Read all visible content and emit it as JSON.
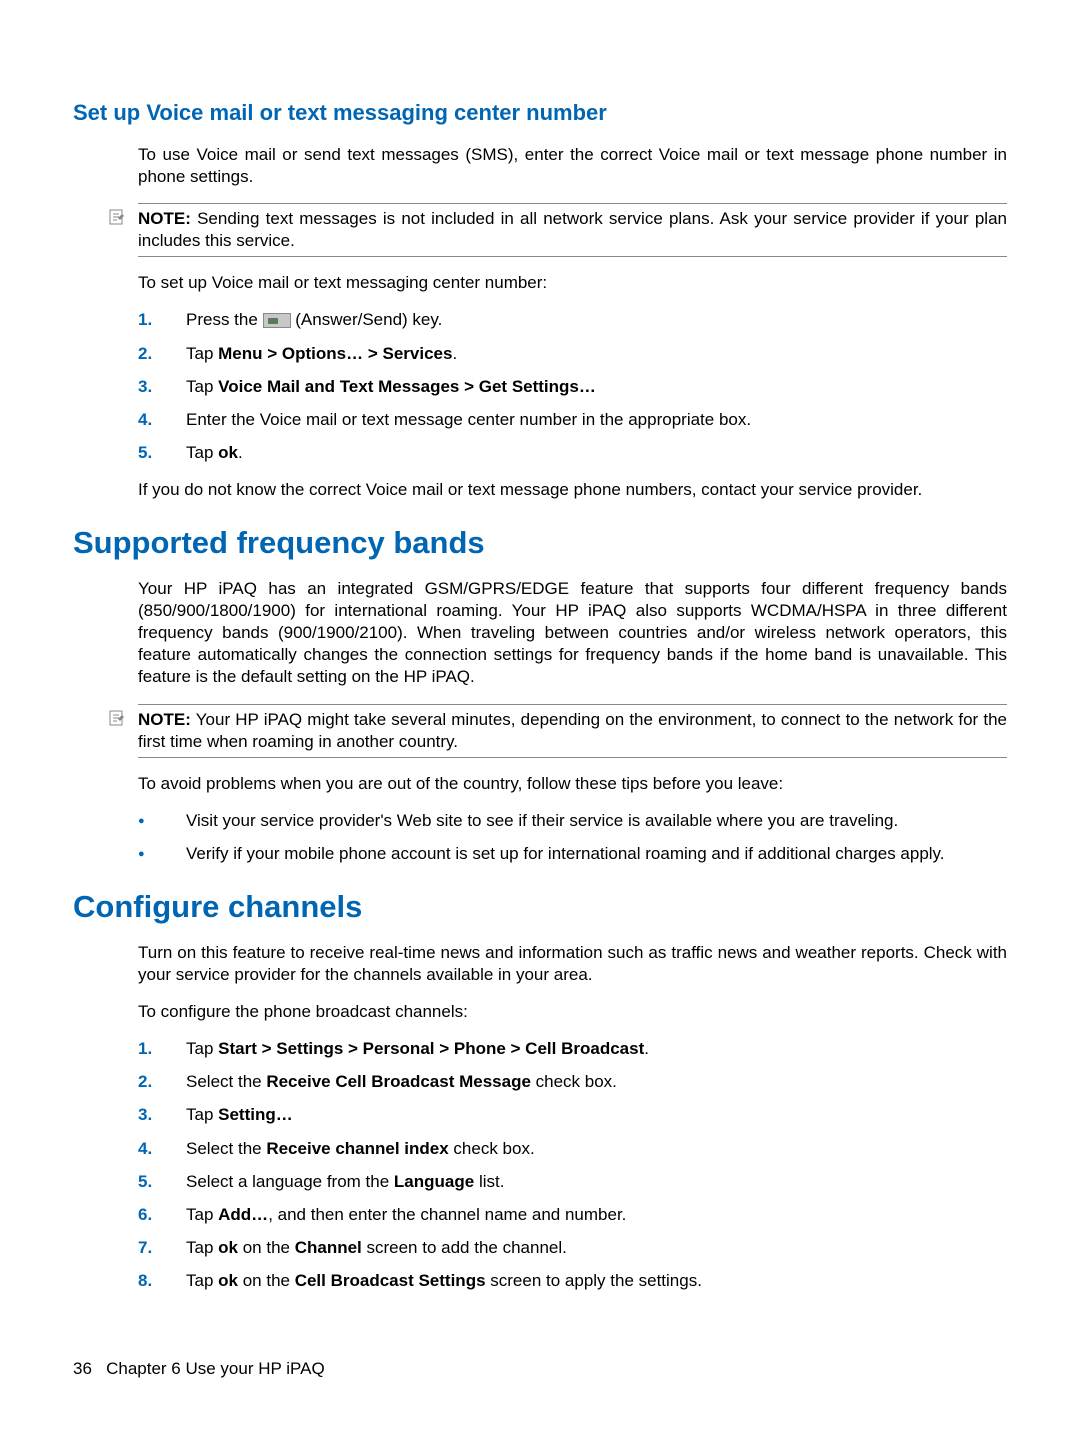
{
  "section1": {
    "heading": "Set up Voice mail or text messaging center number",
    "p1": "To use Voice mail or send text messages (SMS), enter the correct Voice mail or text message phone number in phone settings.",
    "note_prefix": "NOTE:",
    "note": "Sending text messages is not included in all network service plans. Ask your service provider if your plan includes this service.",
    "p2": "To set up Voice mail or text messaging center number:",
    "step1_a": "Press the ",
    "step1_b": " (Answer/Send) key.",
    "step2_a": "Tap ",
    "step2_b": "Menu > Options… > Services",
    "step2_c": ".",
    "step3_a": "Tap ",
    "step3_b": "Voice Mail and Text Messages > Get Settings…",
    "step4": "Enter the Voice mail or text message center number in the appropriate box.",
    "step5_a": "Tap ",
    "step5_b": "ok",
    "step5_c": ".",
    "p3": "If you do not know the correct Voice mail or text message phone numbers, contact your service provider."
  },
  "section2": {
    "heading": "Supported frequency bands",
    "p1": "Your HP iPAQ has an integrated GSM/GPRS/EDGE feature that supports four different frequency bands (850/900/1800/1900) for international roaming. Your HP iPAQ also supports WCDMA/HSPA in three different frequency bands (900/1900/2100). When traveling between countries and/or wireless network operators, this feature automatically changes the connection settings for frequency bands if the home band is unavailable. This feature is the default setting on the HP iPAQ.",
    "note_prefix": "NOTE:",
    "note": "Your HP iPAQ might take several minutes, depending on the environment, to connect to the network for the first time when roaming in another country.",
    "p2": "To avoid problems when you are out of the country, follow these tips before you leave:",
    "b1": "Visit your service provider's Web site to see if their service is available where you are traveling.",
    "b2": "Verify if your mobile phone account is set up for international roaming and if additional charges apply."
  },
  "section3": {
    "heading": "Configure channels",
    "p1": "Turn on this feature to receive real-time news and information such as traffic news and weather reports. Check with your service provider for the channels available in your area.",
    "p2": "To configure the phone broadcast channels:",
    "s1_a": "Tap ",
    "s1_b": "Start > Settings > Personal > Phone > Cell Broadcast",
    "s1_c": ".",
    "s2_a": "Select the ",
    "s2_b": "Receive Cell Broadcast Message",
    "s2_c": " check box.",
    "s3_a": "Tap ",
    "s3_b": "Setting…",
    "s4_a": "Select the ",
    "s4_b": "Receive channel index",
    "s4_c": " check box.",
    "s5_a": "Select a language from the ",
    "s5_b": "Language",
    "s5_c": " list.",
    "s6_a": "Tap ",
    "s6_b": "Add…",
    "s6_c": ", and then enter the channel name and number.",
    "s7_a": "Tap ",
    "s7_b": "ok",
    "s7_c": " on the ",
    "s7_d": "Channel",
    "s7_e": " screen to add the channel.",
    "s8_a": "Tap ",
    "s8_b": "ok",
    "s8_c": " on the ",
    "s8_d": "Cell Broadcast Settings",
    "s8_e": " screen to apply the settings."
  },
  "footer": {
    "page": "36",
    "chapter": "Chapter 6   Use your HP iPAQ"
  }
}
